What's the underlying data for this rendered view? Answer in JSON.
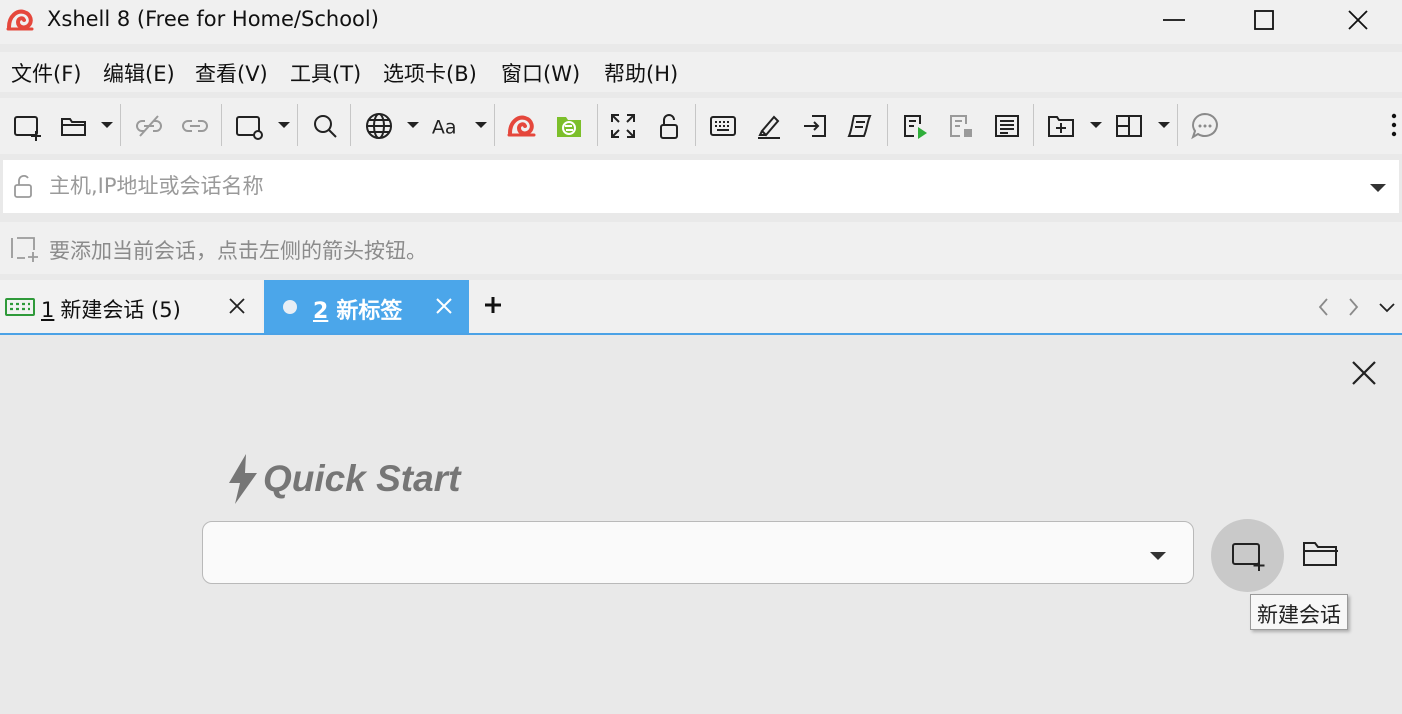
{
  "window": {
    "title": "Xshell 8 (Free for Home/School)",
    "controls": [
      "minimize",
      "maximize",
      "close"
    ]
  },
  "menu": {
    "items": [
      "文件(F)",
      "编辑(E)",
      "查看(V)",
      "工具(T)",
      "选项卡(B)",
      "窗口(W)",
      "帮助(H)"
    ]
  },
  "toolbar": {
    "icons": [
      "new-session-icon",
      "open-session-icon",
      "disconnect-icon",
      "reconnect-icon",
      "session-properties-icon",
      "find-icon",
      "globe-icon",
      "font-icon",
      "xshell-icon",
      "xftp-icon",
      "fullscreen-icon",
      "lock-icon",
      "keyboard-icon",
      "highlight-icon",
      "send-icon",
      "script-icon",
      "run-script-icon",
      "stop-script-icon",
      "notes-icon",
      "new-folder-icon",
      "layout-icon",
      "more-icon",
      "chat-icon"
    ]
  },
  "address": {
    "placeholder": "主机,IP地址或会话名称",
    "value": ""
  },
  "hint": {
    "text": "要添加当前会话，点击左侧的箭头按钮。"
  },
  "tabs": [
    {
      "number": "1",
      "label": "新建会话 (5)",
      "active": false
    },
    {
      "number": "2",
      "label": "新标签",
      "active": true
    }
  ],
  "quick_start": {
    "title": "Quick Start",
    "combo_value": "",
    "tooltip": "新建会话"
  },
  "colors": {
    "accent": "#4ba6ea",
    "logo_red": "#e5473c",
    "xftp_green": "#7cbf2a"
  }
}
